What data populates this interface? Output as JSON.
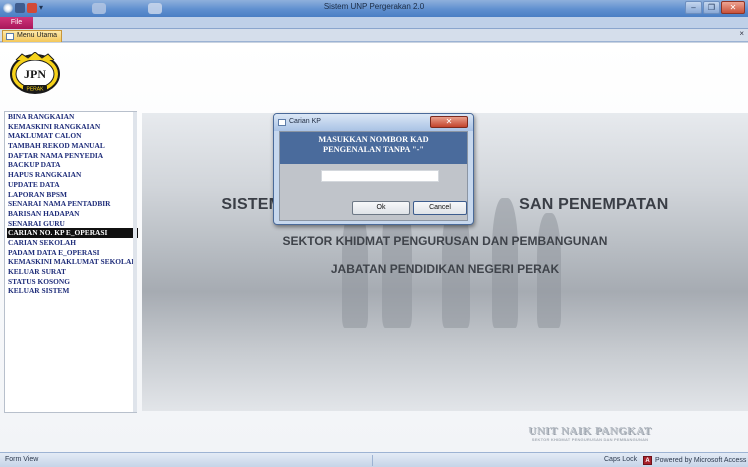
{
  "window": {
    "title": "Sistem UNP Pergerakan 2.0",
    "buttons": {
      "minimize": "–",
      "restore": "❐",
      "close": "✕"
    }
  },
  "ribbon": {
    "file_tab": "File"
  },
  "doc_tab": {
    "label": "Menu Utama",
    "close": "×"
  },
  "logo": {
    "text": "JPN",
    "subtext": "PERAK"
  },
  "menu": {
    "items": [
      "BINA RANGKAIAN",
      "KEMASKINI RANGKAIAN",
      "MAKLUMAT CALON",
      "TAMBAH REKOD MANUAL",
      "DAFTAR NAMA PENYEDIA",
      "BACKUP DATA",
      "HAPUS RANGKAIAN",
      "UPDATE DATA",
      "LAPORAN BPSM",
      "SENARAI NAMA PENTADBIR",
      "BARISAN HADAPAN",
      "SENARAI GURU",
      "CARIAN NO. KP E_OPERASI",
      "CARIAN SEKOLAH",
      "PADAM DATA E_OPERASI",
      "KEMASKINI MAKLUMAT SEKOLAH",
      "KELUAR SURAT",
      "STATUS KOSONG",
      "KELUAR SISTEM"
    ],
    "active_index": 12
  },
  "banner": {
    "line1": "SISTEM                                                   SAN PENEMPATAN",
    "line2": "SEKTOR KHIDMAT PENGURUSAN DAN PEMBANGUNAN",
    "line3": "JABATAN PENDIDIKAN NEGERI PERAK"
  },
  "watermark": {
    "line1": "UNIT NAIK PANGKAT",
    "line2": "SEKTOR KHIDMAT PENGURUSAN DAN PEMBANGUNAN"
  },
  "dialog": {
    "title": "Carian KP",
    "close": "✕",
    "header_line1": "MASUKKAN NOMBOR KAD",
    "header_line2": "PENGENALAN TANPA \"-\"",
    "input_value": "",
    "ok_label": "Ok",
    "cancel_label": "Cancel"
  },
  "status": {
    "view": "Form View",
    "caps": "Caps Lock",
    "powered": "Powered by Microsoft Access",
    "access_icon": "A"
  }
}
